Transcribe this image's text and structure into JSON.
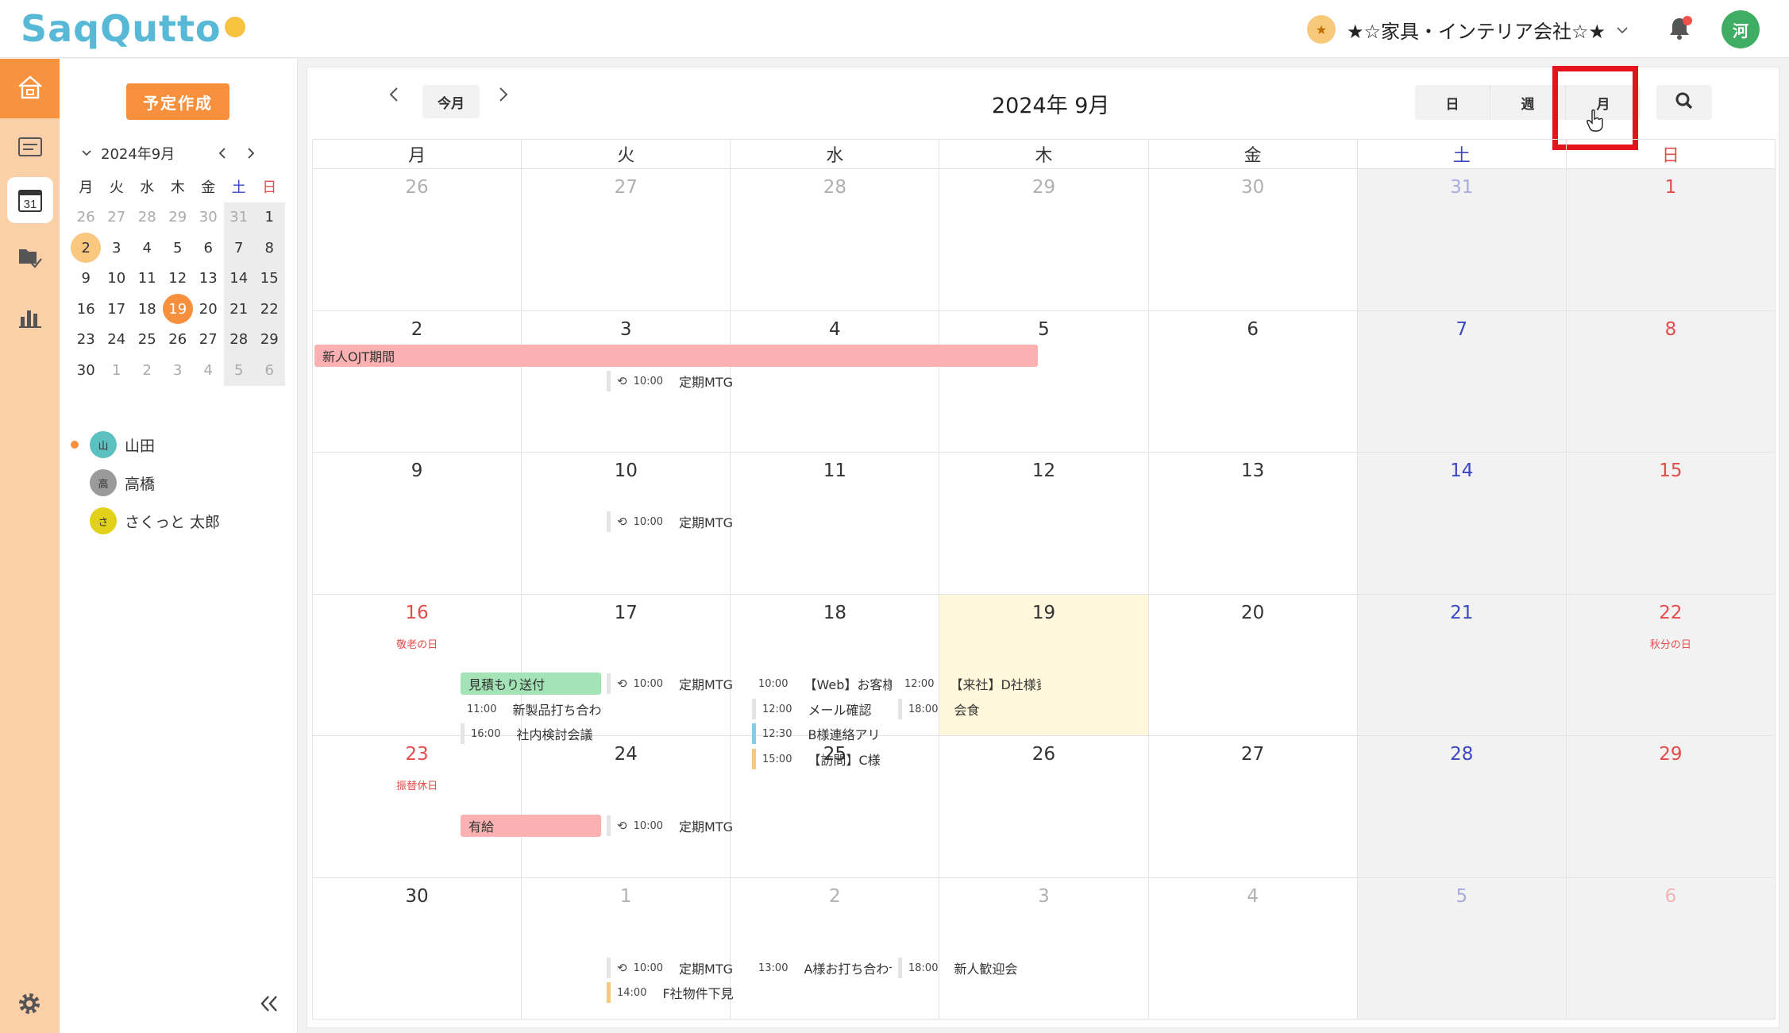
{
  "header": {
    "logo_text": "SaqQutto",
    "company_name": "★☆家具・インテリア会社☆★",
    "user_initial": "河"
  },
  "leftpanel": {
    "create_label": "予定作成",
    "mini_title": "2024年9月",
    "weekdays": [
      "月",
      "火",
      "水",
      "木",
      "金",
      "土",
      "日"
    ],
    "mini_weeks": [
      [
        "26",
        "27",
        "28",
        "29",
        "30",
        "31",
        "1"
      ],
      [
        "2",
        "3",
        "4",
        "5",
        "6",
        "7",
        "8"
      ],
      [
        "9",
        "10",
        "11",
        "12",
        "13",
        "14",
        "15"
      ],
      [
        "16",
        "17",
        "18",
        "19",
        "20",
        "21",
        "22"
      ],
      [
        "23",
        "24",
        "25",
        "26",
        "27",
        "28",
        "29"
      ],
      [
        "30",
        "1",
        "2",
        "3",
        "4",
        "5",
        "6"
      ]
    ],
    "members": [
      {
        "initial": "山",
        "name": "山田",
        "color": "#5bc0c0"
      },
      {
        "initial": "高",
        "name": "高橋",
        "color": "#9a9a9a"
      },
      {
        "initial": "さ",
        "name": "さくっと 太郎",
        "color": "#e2d11a"
      }
    ]
  },
  "calendar": {
    "today_label": "今月",
    "title": "2024年 9月",
    "views": [
      "日",
      "週",
      "月"
    ],
    "weekdays": [
      "月",
      "火",
      "水",
      "木",
      "金",
      "土",
      "日"
    ],
    "weeks": [
      {
        "days": [
          "26",
          "27",
          "28",
          "29",
          "30",
          "31",
          "1"
        ]
      },
      {
        "days": [
          "2",
          "3",
          "4",
          "5",
          "6",
          "7",
          "8"
        ]
      },
      {
        "days": [
          "9",
          "10",
          "11",
          "12",
          "13",
          "14",
          "15"
        ]
      },
      {
        "days": [
          "16",
          "17",
          "18",
          "19",
          "20",
          "21",
          "22"
        ]
      },
      {
        "days": [
          "23",
          "24",
          "25",
          "26",
          "27",
          "28",
          "29"
        ]
      },
      {
        "days": [
          "30",
          "1",
          "2",
          "3",
          "4",
          "5",
          "6"
        ]
      }
    ],
    "holidays": {
      "keiro": "敬老の日",
      "shubun": "秋分の日",
      "furikae": "振替休日"
    },
    "events": {
      "ojt": "新人OJT期間",
      "teiki": "定期MTG",
      "time_1000": "10:00",
      "mitsumori": "見積もり送付",
      "e17_1_time": "11:00",
      "e17_1": "新製品打ち合わせ",
      "e17_2_time": "16:00",
      "e17_2": "社内検討会議",
      "e19_1_time": "10:00",
      "e19_1": "【Web】お客様打ち合わせ",
      "e19_2_time": "12:00",
      "e19_2": "メール確認",
      "e19_3_time": "12:30",
      "e19_3": "B様連絡アリ",
      "e19_4_time": "15:00",
      "e19_4": "【訪問】C様",
      "e20_1_time": "12:00",
      "e20_1": "【来社】D社様資材調整",
      "e20_2_time": "18:00",
      "e20_2": "会食",
      "yukyu": "有給",
      "eo2_time": "14:00",
      "eo2": "F社物件下見",
      "eo3_time": "13:00",
      "eo3": "A様お打ち合わせ_最終確認",
      "eo4_time": "18:00",
      "eo4": "新人歓迎会"
    }
  },
  "colors": {
    "accent": "#f7903c",
    "ojt_bar": "#fbb1b1",
    "mitsumori": "#a4e3b6",
    "today_bg": "#fff8dc",
    "highlight": "#e3141b"
  }
}
